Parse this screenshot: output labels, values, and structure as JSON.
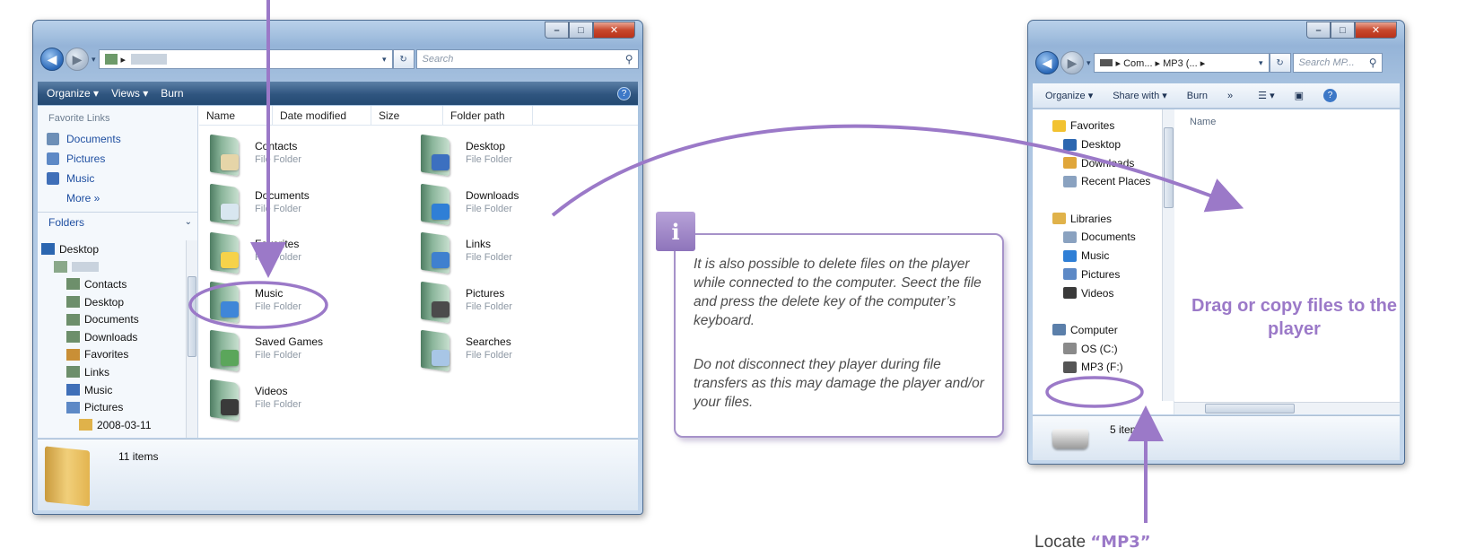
{
  "window1": {
    "address": "▸",
    "search_placeholder": "Search",
    "toolbar": {
      "organize": "Organize ▾",
      "views": "Views ▾",
      "burn": "Burn"
    },
    "favorite_links_header": "Favorite Links",
    "favorite_links": [
      "Documents",
      "Pictures",
      "Music"
    ],
    "more_label": "More »",
    "folders_header": "Folders",
    "tree": [
      {
        "label": "Desktop",
        "indent": 0
      },
      {
        "label": "",
        "indent": 1
      },
      {
        "label": "Contacts",
        "indent": 2
      },
      {
        "label": "Desktop",
        "indent": 2
      },
      {
        "label": "Documents",
        "indent": 2
      },
      {
        "label": "Downloads",
        "indent": 2
      },
      {
        "label": "Favorites",
        "indent": 2
      },
      {
        "label": "Links",
        "indent": 2
      },
      {
        "label": "Music",
        "indent": 2
      },
      {
        "label": "Pictures",
        "indent": 2
      },
      {
        "label": "2008-03-11",
        "indent": 3
      }
    ],
    "columns": [
      "Name",
      "Date modified",
      "Size",
      "Folder path"
    ],
    "files": [
      {
        "name": "Contacts",
        "type": "File Folder"
      },
      {
        "name": "Documents",
        "type": "File Folder"
      },
      {
        "name": "Favorites",
        "type": "File Folder"
      },
      {
        "name": "Music",
        "type": "File Folder"
      },
      {
        "name": "Saved Games",
        "type": "File Folder"
      },
      {
        "name": "Videos",
        "type": "File Folder"
      },
      {
        "name": "Desktop",
        "type": "File Folder"
      },
      {
        "name": "Downloads",
        "type": "File Folder"
      },
      {
        "name": "Links",
        "type": "File Folder"
      },
      {
        "name": "Pictures",
        "type": "File Folder"
      },
      {
        "name": "Searches",
        "type": "File Folder"
      }
    ],
    "item_count": "11 items"
  },
  "window2": {
    "address": "▸ Com... ▸ MP3 (... ▸",
    "search_placeholder": "Search MP...",
    "toolbar": {
      "organize": "Organize ▾",
      "share": "Share with ▾",
      "burn": "Burn",
      "more": "»"
    },
    "column_name": "Name",
    "nav": [
      {
        "label": "Favorites",
        "indent": 0
      },
      {
        "label": "Desktop",
        "indent": 1
      },
      {
        "label": "Downloads",
        "indent": 1
      },
      {
        "label": "Recent Places",
        "indent": 1
      },
      {
        "label": "",
        "indent": 0
      },
      {
        "label": "Libraries",
        "indent": 0
      },
      {
        "label": "Documents",
        "indent": 1
      },
      {
        "label": "Music",
        "indent": 1
      },
      {
        "label": "Pictures",
        "indent": 1
      },
      {
        "label": "Videos",
        "indent": 1
      },
      {
        "label": "",
        "indent": 0
      },
      {
        "label": "Computer",
        "indent": 0
      },
      {
        "label": "OS (C:)",
        "indent": 1
      },
      {
        "label": "MP3 (F:)",
        "indent": 1
      }
    ],
    "item_count": "5 items",
    "drag_text": "Drag or copy files to the player"
  },
  "info": {
    "icon": "i",
    "paragraph1": "It is also possible to delete files on the player while connected to the computer. Seect the file and press the delete key of the computer’s keyboard.",
    "paragraph2": "Do not disconnect they player during file transfers as this may damage the player and/or your files."
  },
  "locate": {
    "prefix": "Locate ",
    "target": "“MP3”"
  },
  "colors": {
    "accent": "#9b79c8",
    "toolbar_dark": "#2f557f",
    "link_blue": "#1f4fa1"
  }
}
